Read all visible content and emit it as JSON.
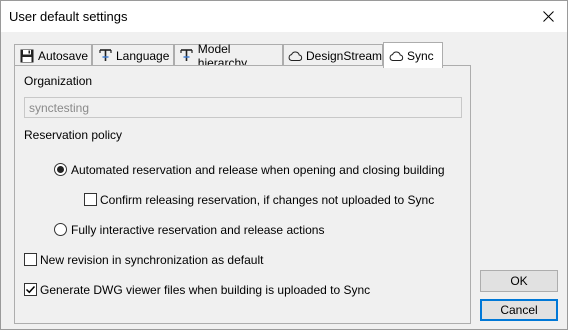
{
  "window": {
    "title": "User default settings"
  },
  "tabs": [
    {
      "label": "Autosave",
      "icon": "floppy-disk-icon"
    },
    {
      "label": "Language",
      "icon": "language-icon"
    },
    {
      "label": "Model hierarchy",
      "icon": "hierarchy-icon"
    },
    {
      "label": "DesignStream",
      "icon": "cloud-icon"
    },
    {
      "label": "Sync",
      "icon": "cloud-icon",
      "active": true
    }
  ],
  "sync": {
    "organization_label": "Organization",
    "organization_value": "synctesting",
    "reservation_policy_label": "Reservation policy",
    "option_automated": "Automated reservation and release when opening and closing building",
    "confirm_release": "Confirm releasing reservation, if changes not uploaded to Sync",
    "option_interactive": "Fully interactive reservation and release actions",
    "new_revision": "New revision in synchronization as default",
    "generate_dwg": "Generate DWG viewer files when building is uploaded to Sync",
    "state": {
      "automated_selected": true,
      "interactive_selected": false,
      "confirm_release_checked": false,
      "new_revision_checked": false,
      "generate_dwg_checked": true
    }
  },
  "buttons": {
    "ok": "OK",
    "cancel": "Cancel"
  },
  "colors": {
    "accent": "#0078d7",
    "panel_bg": "#f0f0f0",
    "tab_border": "#adadad"
  }
}
